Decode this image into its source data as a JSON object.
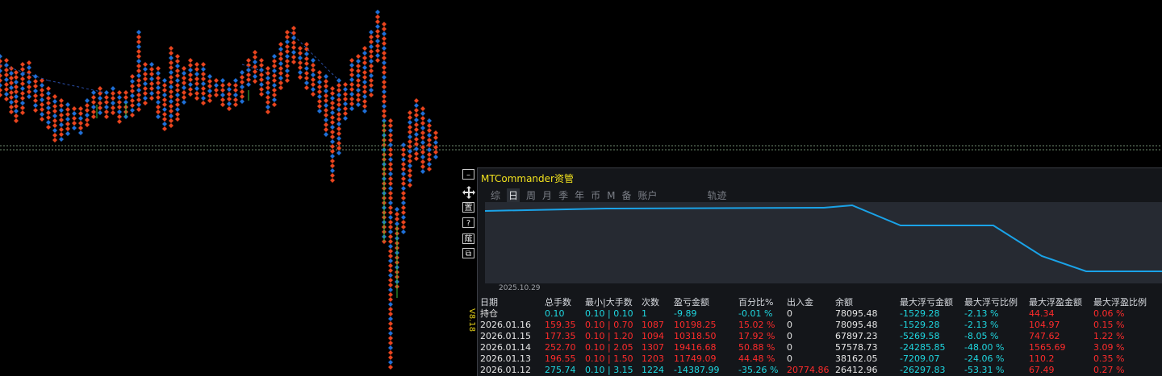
{
  "panel": {
    "title": "MTCommander资管",
    "version": "V8.18",
    "tabs": [
      "综",
      "日",
      "周",
      "月",
      "季",
      "年",
      "币",
      "M",
      "备",
      "账户",
      "轨迹"
    ],
    "active_tab": "日",
    "toolbar": {
      "move_icon": "move-icon",
      "btn1": "置",
      "btn2": "?",
      "btn3": "䕃",
      "btn4": "⧉"
    },
    "equity_start_date": "2025.10.29"
  },
  "colors": {
    "background": "#000000",
    "panel": "#14161a",
    "equity_line": "#1aa3e8",
    "positive": "#1fd7e0",
    "negative": "#ff2b2b",
    "title": "#f2e21e",
    "candle_up": "#1f6fd6",
    "candle_down": "#e8441e"
  },
  "table": {
    "headers": [
      "日期",
      "总手数",
      "最小|大手数",
      "次数",
      "盈亏金额",
      "百分比%",
      "出入金",
      "余额",
      "最大浮亏金额",
      "最大浮亏比例",
      "最大浮盈金额",
      "最大浮盈比例"
    ],
    "rows": [
      {
        "date": "持仓",
        "lots": "0.10",
        "minmax": "0.10 | 0.10",
        "count": "1",
        "pnl": "-9.89",
        "pct": "-0.01 %",
        "flow": "0",
        "balance": "78095.48",
        "max_float_loss": "-1529.28",
        "max_float_loss_pct": "-2.13 %",
        "max_float_profit": "44.34",
        "max_float_profit_pct": "0.06 %",
        "tone": "cyan",
        "profit_tone": "red",
        "date_tone": "white"
      },
      {
        "date": "2026.01.16",
        "lots": "159.35",
        "minmax": "0.10 | 0.70",
        "count": "1087",
        "pnl": "10198.25",
        "pct": "15.02 %",
        "flow": "0",
        "balance": "78095.48",
        "max_float_loss": "-1529.28",
        "max_float_loss_pct": "-2.13 %",
        "max_float_profit": "104.97",
        "max_float_profit_pct": "0.15 %",
        "tone": "red",
        "profit_tone": "red",
        "date_tone": "white"
      },
      {
        "date": "2026.01.15",
        "lots": "177.35",
        "minmax": "0.10 | 1.20",
        "count": "1094",
        "pnl": "10318.50",
        "pct": "17.92 %",
        "flow": "0",
        "balance": "67897.23",
        "max_float_loss": "-5269.58",
        "max_float_loss_pct": "-8.05 %",
        "max_float_profit": "747.62",
        "max_float_profit_pct": "1.22 %",
        "tone": "red",
        "profit_tone": "red",
        "date_tone": "white"
      },
      {
        "date": "2026.01.14",
        "lots": "252.70",
        "minmax": "0.10 | 2.05",
        "count": "1307",
        "pnl": "19416.68",
        "pct": "50.88 %",
        "flow": "0",
        "balance": "57578.73",
        "max_float_loss": "-24285.85",
        "max_float_loss_pct": "-48.00 %",
        "max_float_profit": "1565.69",
        "max_float_profit_pct": "3.09 %",
        "tone": "red",
        "profit_tone": "red",
        "date_tone": "white"
      },
      {
        "date": "2026.01.13",
        "lots": "196.55",
        "minmax": "0.10 | 1.50",
        "count": "1203",
        "pnl": "11749.09",
        "pct": "44.48 %",
        "flow": "0",
        "balance": "38162.05",
        "max_float_loss": "-7209.07",
        "max_float_loss_pct": "-24.06 %",
        "max_float_profit": "110.2",
        "max_float_profit_pct": "0.35 %",
        "tone": "red",
        "profit_tone": "red",
        "date_tone": "white"
      },
      {
        "date": "2026.01.12",
        "lots": "275.74",
        "minmax": "0.10 | 3.15",
        "count": "1224",
        "pnl": "-14387.99",
        "pct": "-35.26 %",
        "flow": "20774.86",
        "balance": "26412.96",
        "max_float_loss": "-26297.83",
        "max_float_loss_pct": "-53.31 %",
        "max_float_profit": "67.49",
        "max_float_profit_pct": "0.27 %",
        "tone": "cyan",
        "profit_tone": "red",
        "date_tone": "white",
        "flow_tone": "red"
      }
    ]
  },
  "equity_curve": [
    78095,
    78095,
    78095,
    78095,
    78095,
    78095,
    78095,
    78095,
    78095,
    78095,
    78095,
    78095,
    67897,
    67897,
    67897,
    57579,
    57579,
    38162,
    26413
  ]
}
